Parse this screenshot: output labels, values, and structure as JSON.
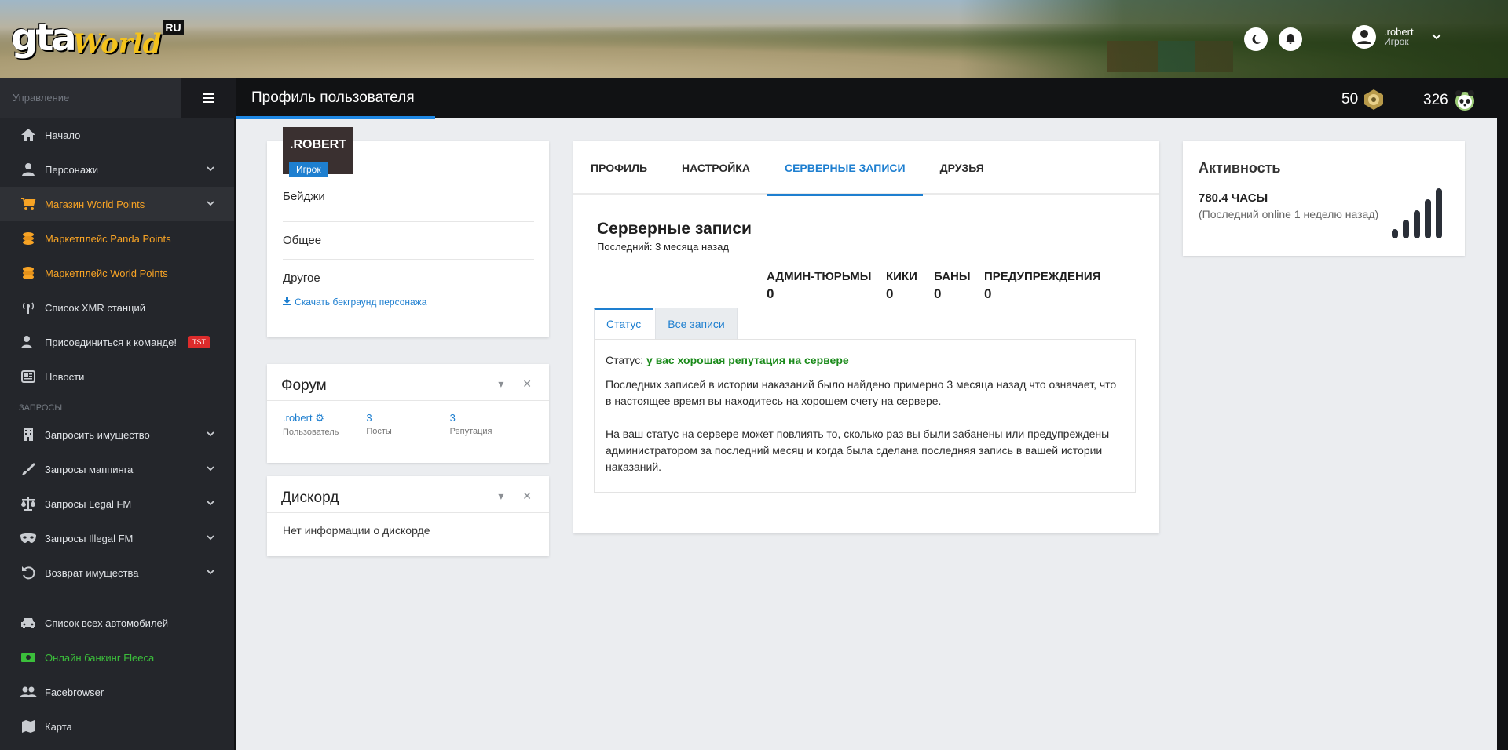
{
  "banner": {
    "logo": {
      "gta": "gta",
      "world": "World",
      "ru": "RU"
    },
    "user": {
      "name": ".robert",
      "role": "Игрок"
    }
  },
  "sidebar": {
    "section_manage": "Управление",
    "items_main": [
      {
        "label": "Начало",
        "icon": "home-icon"
      },
      {
        "label": "Персонажи",
        "icon": "person-icon"
      },
      {
        "label": "Магазин World Points",
        "icon": "cart-icon"
      },
      {
        "label": "Маркетплейс Panda Points",
        "icon": "coins-icon"
      },
      {
        "label": "Маркетплейс World Points",
        "icon": "coins-icon"
      },
      {
        "label": "Список XMR станций",
        "icon": "antenna-icon"
      },
      {
        "label": "Присоединиться к команде!",
        "icon": "user-plus-icon",
        "badge": "TST"
      },
      {
        "label": "Новости",
        "icon": "newspaper-icon"
      }
    ],
    "section_requests": "ЗАПРОСЫ",
    "items_requests": [
      {
        "label": "Запросить имущество",
        "icon": "building-icon"
      },
      {
        "label": "Запросы маппинга",
        "icon": "brush-icon"
      },
      {
        "label": "Запросы Legal FM",
        "icon": "scales-icon"
      },
      {
        "label": "Запросы Illegal FM",
        "icon": "mask-icon"
      },
      {
        "label": "Возврат имущества",
        "icon": "undo-icon"
      }
    ],
    "items_other": [
      {
        "label": "Список всех автомобилей",
        "icon": "car-icon"
      },
      {
        "label": "Онлайн банкинг Fleeca",
        "icon": "money-icon"
      },
      {
        "label": "Facebrowser",
        "icon": "users-icon"
      },
      {
        "label": "Карта",
        "icon": "map-icon"
      }
    ]
  },
  "header": {
    "title": "Профиль пользователя",
    "stat1": "50",
    "stat2": "326"
  },
  "profile": {
    "name": ".ROBERT",
    "role": "Игрок",
    "badges_label": "Бейджи",
    "general_label": "Общее",
    "other_label": "Другое",
    "download_link": "Скачать бекграунд персонажа"
  },
  "forum": {
    "title": "Форум",
    "user": ".robert",
    "user_label": "Пользователь",
    "posts": "3",
    "posts_label": "Посты",
    "reputation": "3",
    "reputation_label": "Репутация"
  },
  "discord": {
    "title": "Дискорд",
    "text": "Нет информации о дискорде"
  },
  "main": {
    "tabs": [
      "ПРОФИЛЬ",
      "НАСТРОЙКА",
      "СЕРВЕРНЫЕ ЗАПИСИ",
      "ДРУЗЬЯ"
    ],
    "section_title": "Серверные записи",
    "section_sub": "Последний: 3 месяца назад",
    "counters": [
      {
        "label": "АДМИН-ТЮРЬМЫ",
        "value": "0"
      },
      {
        "label": "КИКИ",
        "value": "0"
      },
      {
        "label": "БАНЫ",
        "value": "0"
      },
      {
        "label": "ПРЕДУПРЕЖДЕНИЯ",
        "value": "0"
      }
    ],
    "subtabs": [
      "Статус",
      "Все записи"
    ],
    "status_prefix": "Статус:",
    "status_value": "у вас хорошая репутация на сервере",
    "para1": "Последних записей в истории наказаний было найдено примерно 3 месяца назад что означает, что в настоящее время вы находитесь на хорошем счету на сервере.",
    "para2": "На ваш статус на сервере может повлиять то, сколько раз вы были забанены или предупреждены администратором за последний месяц и когда была сделана последняя запись в вашей истории наказаний."
  },
  "activity": {
    "title": "Активность",
    "hours": "780.4 ЧАСЫ",
    "last_online": "(Последний online 1 неделю назад)"
  },
  "colors": {
    "accent": "#1e7fd0",
    "sidebar_bg": "#24262b",
    "orange": "#f7a325",
    "green": "#3bbf3b",
    "status_green": "#1a8a1a"
  }
}
